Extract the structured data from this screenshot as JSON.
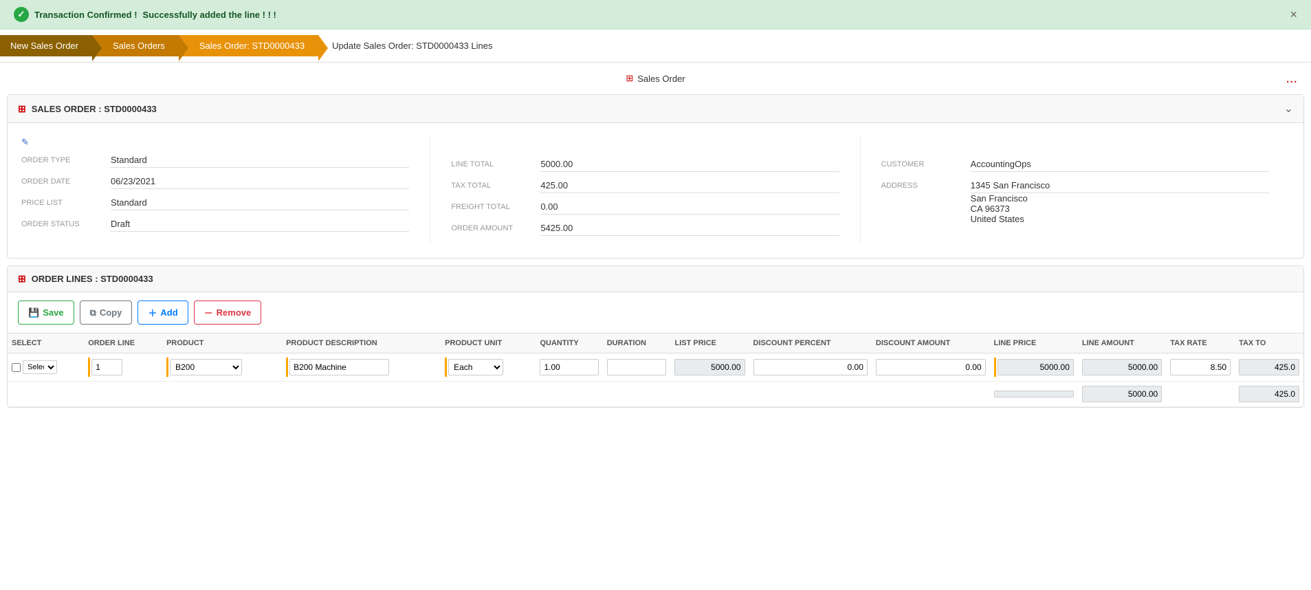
{
  "banner": {
    "message_bold": "Transaction Confirmed !",
    "message_normal": " Successfully added the line ! ! !",
    "close_label": "×"
  },
  "breadcrumb": {
    "items": [
      {
        "label": "New Sales Order"
      },
      {
        "label": "Sales Orders"
      },
      {
        "label": "Sales Order: STD0000433"
      }
    ],
    "current_page": "Update Sales Order: STD0000433 Lines"
  },
  "page": {
    "title": "Sales Order",
    "dots": "...",
    "grid_icon": "⊞"
  },
  "sales_order_section": {
    "title": "SALES ORDER : STD0000433",
    "fields": {
      "order_type_label": "ORDER TYPE",
      "order_type_value": "Standard",
      "order_date_label": "ORDER DATE",
      "order_date_value": "06/23/2021",
      "price_list_label": "PRICE LIST",
      "price_list_value": "Standard",
      "order_status_label": "ORDER STATUS",
      "order_status_value": "Draft",
      "line_total_label": "LINE TOTAL",
      "line_total_value": "5000.00",
      "tax_total_label": "TAX TOTAL",
      "tax_total_value": "425.00",
      "freight_total_label": "FREIGHT TOTAL",
      "freight_total_value": "0.00",
      "order_amount_label": "ORDER AMOUNT",
      "order_amount_value": "5425.00",
      "customer_label": "CUSTOMER",
      "customer_value": "AccountingOps",
      "address_label": "ADDRESS",
      "address_line1": "1345 San Francisco",
      "address_line2": "San Francisco",
      "address_line3": "CA 96373",
      "address_line4": "United States"
    }
  },
  "order_lines_section": {
    "title": "ORDER LINES : STD0000433",
    "toolbar": {
      "save_label": "Save",
      "copy_label": "Copy",
      "add_label": "Add",
      "remove_label": "Remove"
    },
    "table": {
      "headers": [
        "SELECT",
        "ORDER LINE",
        "PRODUCT",
        "PRODUCT DESCRIPTION",
        "PRODUCT UNIT",
        "QUANTITY",
        "DURATION",
        "LIST PRICE",
        "DISCOUNT PERCENT",
        "DISCOUNT AMOUNT",
        "LINE PRICE",
        "LINE AMOUNT",
        "TAX RATE",
        "TAX TO"
      ],
      "rows": [
        {
          "select": false,
          "select_label": "Select",
          "order_line": "1",
          "product": "B200",
          "product_description": "B200 Machine",
          "product_unit": "Each",
          "quantity": "1.00",
          "duration": "",
          "list_price": "5000.00",
          "discount_percent": "0.00",
          "discount_amount": "0.00",
          "line_price": "5000.00",
          "line_amount": "5000.00",
          "tax_rate": "8.50",
          "tax_total": "425.0"
        }
      ],
      "totals": {
        "line_amount": "5000.00",
        "tax_total": "425.0"
      }
    }
  }
}
